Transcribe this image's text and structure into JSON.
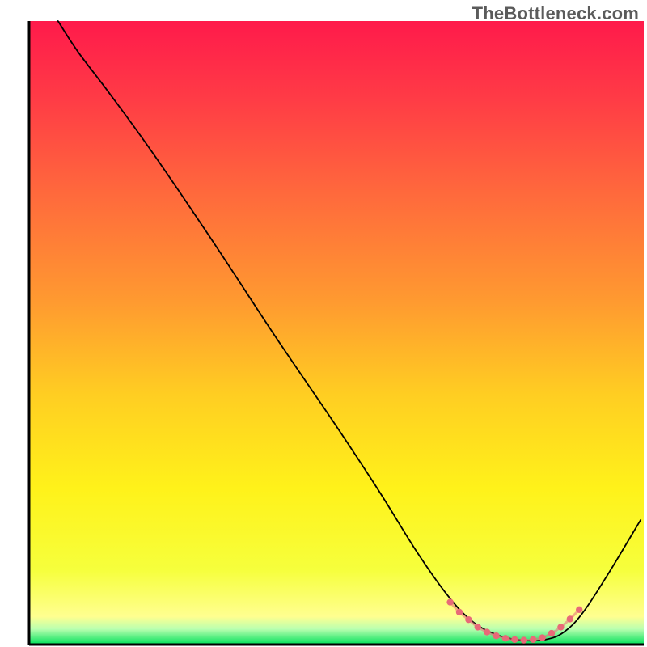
{
  "watermark": "TheBottleneck.com",
  "chart_data": {
    "type": "line",
    "title": "",
    "xlabel": "",
    "ylabel": "",
    "xlim": [
      0,
      100
    ],
    "ylim": [
      0,
      100
    ],
    "grid": false,
    "legend": false,
    "background": {
      "type": "vertical-gradient",
      "stops": [
        {
          "offset": 0.0,
          "color": "#ff1a4b"
        },
        {
          "offset": 0.12,
          "color": "#ff3a46"
        },
        {
          "offset": 0.28,
          "color": "#ff6a3c"
        },
        {
          "offset": 0.45,
          "color": "#ff9a30"
        },
        {
          "offset": 0.6,
          "color": "#ffce22"
        },
        {
          "offset": 0.75,
          "color": "#fff21a"
        },
        {
          "offset": 0.88,
          "color": "#f6ff3c"
        },
        {
          "offset": 0.955,
          "color": "#ffff90"
        },
        {
          "offset": 0.975,
          "color": "#baffb0"
        },
        {
          "offset": 1.0,
          "color": "#00e05a"
        }
      ]
    },
    "axes": {
      "left": {
        "x": 4.5,
        "y0": 3.2,
        "y1": 99.6
      },
      "bottom": {
        "y": 99.6,
        "x0": 4.5,
        "x1": 99.6
      }
    },
    "series": [
      {
        "name": "bottleneck-curve",
        "color": "#000000",
        "width": 1.8,
        "points": [
          {
            "x": 4.7,
            "y": 100.0
          },
          {
            "x": 8.0,
            "y": 95.0
          },
          {
            "x": 13.0,
            "y": 88.5
          },
          {
            "x": 20.0,
            "y": 79.0
          },
          {
            "x": 30.0,
            "y": 64.5
          },
          {
            "x": 40.0,
            "y": 49.5
          },
          {
            "x": 50.0,
            "y": 35.0
          },
          {
            "x": 57.0,
            "y": 24.5
          },
          {
            "x": 63.0,
            "y": 15.0
          },
          {
            "x": 68.0,
            "y": 8.0
          },
          {
            "x": 72.0,
            "y": 3.8
          },
          {
            "x": 76.0,
            "y": 1.6
          },
          {
            "x": 80.0,
            "y": 0.7
          },
          {
            "x": 84.0,
            "y": 0.8
          },
          {
            "x": 87.0,
            "y": 2.0
          },
          {
            "x": 90.0,
            "y": 5.0
          },
          {
            "x": 94.0,
            "y": 11.0
          },
          {
            "x": 99.5,
            "y": 20.0
          }
        ]
      }
    ],
    "dot_band": {
      "name": "optimal-range-markers",
      "color": "#e86a78",
      "radius": 4.2,
      "points": [
        {
          "x": 68.5,
          "y": 6.8
        },
        {
          "x": 70.0,
          "y": 5.2
        },
        {
          "x": 71.5,
          "y": 4.0
        },
        {
          "x": 73.0,
          "y": 2.8
        },
        {
          "x": 74.5,
          "y": 2.0
        },
        {
          "x": 76.0,
          "y": 1.4
        },
        {
          "x": 77.5,
          "y": 1.0
        },
        {
          "x": 79.0,
          "y": 0.8
        },
        {
          "x": 80.5,
          "y": 0.7
        },
        {
          "x": 82.0,
          "y": 0.8
        },
        {
          "x": 83.5,
          "y": 1.1
        },
        {
          "x": 85.0,
          "y": 1.8
        },
        {
          "x": 86.5,
          "y": 2.8
        },
        {
          "x": 88.0,
          "y": 4.1
        },
        {
          "x": 89.5,
          "y": 5.6
        }
      ]
    }
  }
}
